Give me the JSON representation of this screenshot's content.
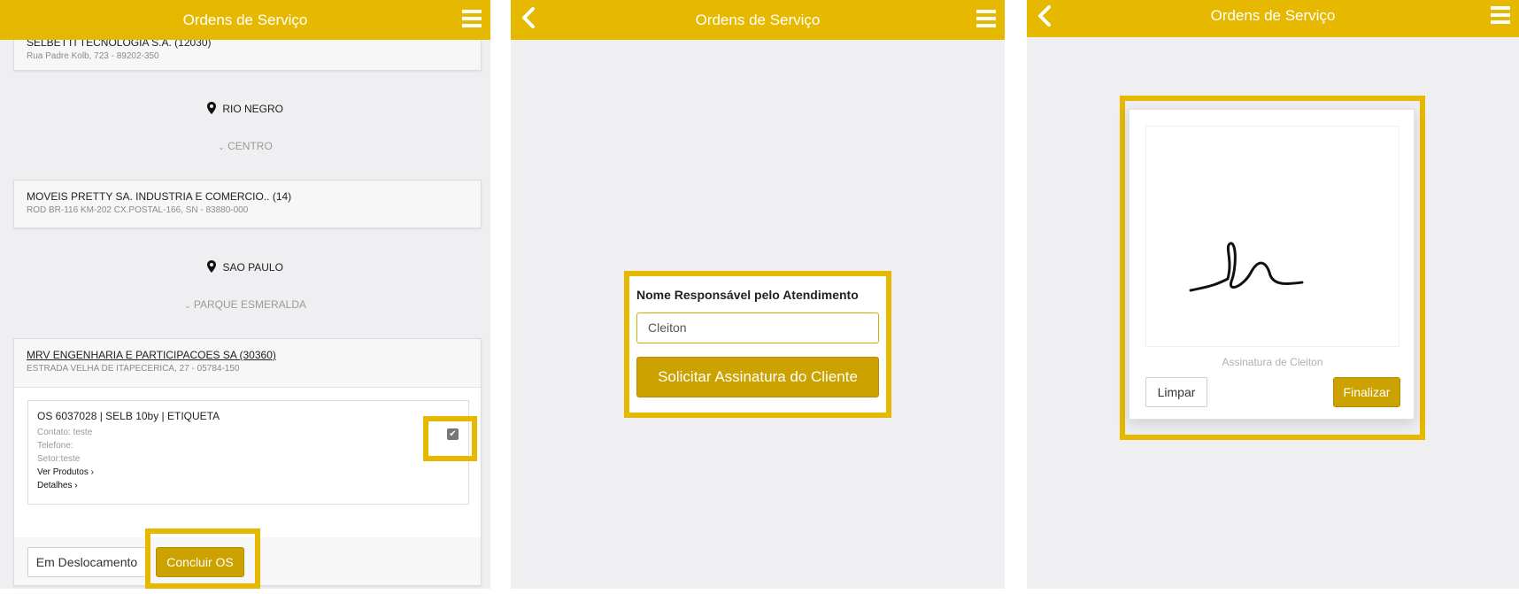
{
  "panel1": {
    "title": "Ordens de Serviço",
    "partial_company_name": "SELBETTI TECNOLOGIA S.A. (12030)",
    "partial_company_addr": "Rua Padre Kolb, 723 - 89202-350",
    "city1": "RIO NEGRO",
    "hood1": "CENTRO",
    "company2_name": "MOVEIS PRETTY SA. INDUSTRIA E COMERCIO.. (14)",
    "company2_addr": "ROD BR-116 KM-202 CX.POSTAL-166, SN - 83880-000",
    "city2": "SAO PAULO",
    "hood2": "PARQUE ESMERALDA",
    "company3_name": "MRV ENGENHARIA E PARTICIPACOES SA (30360)",
    "company3_addr": "ESTRADA VELHA DE ITAPECERICA, 27 - 05784-150",
    "os": {
      "title": "OS 6037028 | SELB 10by | ETIQUETA",
      "contato": "Contato: teste",
      "telefone": "Telefone:",
      "setor": "Setor:teste",
      "ver_produtos": "Ver Produtos",
      "detalhes": "Detalhes",
      "checked": true
    },
    "btn_deslocamento": "Em Deslocamento",
    "btn_concluir": "Concluir OS"
  },
  "panel2": {
    "title": "Ordens de Serviço",
    "field_label": "Nome Responsável pelo Atendimento",
    "field_value": "Cleiton",
    "btn_solicitar": "Solicitar Assinatura do Cliente"
  },
  "panel3": {
    "title": "Ordens de Serviço",
    "caption": "Assinatura de Cleiton",
    "btn_limpar": "Limpar",
    "btn_finalizar": "Finalizar"
  },
  "colors": {
    "brand": "#e6b800",
    "button_gold": "#cca200",
    "background": "#efeff1"
  },
  "icons": [
    "menu-icon",
    "back-icon",
    "map-pin-icon",
    "chevron-down-icon",
    "chevron-right-icon",
    "checkbox-icon"
  ]
}
